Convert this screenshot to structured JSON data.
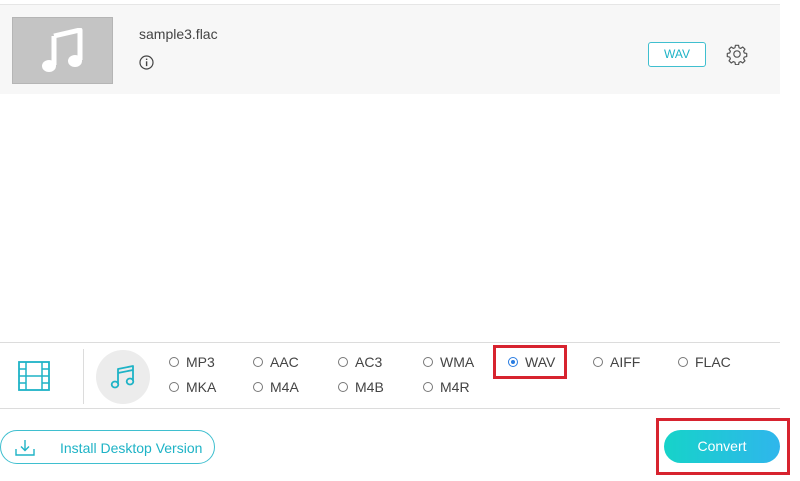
{
  "file": {
    "name": "sample3.flac",
    "target_format": "WAV"
  },
  "formats": {
    "row1": [
      "MP3",
      "AAC",
      "AC3",
      "WMA",
      "WAV",
      "AIFF",
      "FLAC"
    ],
    "row2": [
      "MKA",
      "M4A",
      "M4B",
      "M4R"
    ],
    "selected": "WAV"
  },
  "actions": {
    "install_label": "Install Desktop Version",
    "convert_label": "Convert"
  },
  "colors": {
    "accent": "#1eb3c6",
    "highlight": "#d7232f",
    "radio_selected": "#2a7de1"
  }
}
